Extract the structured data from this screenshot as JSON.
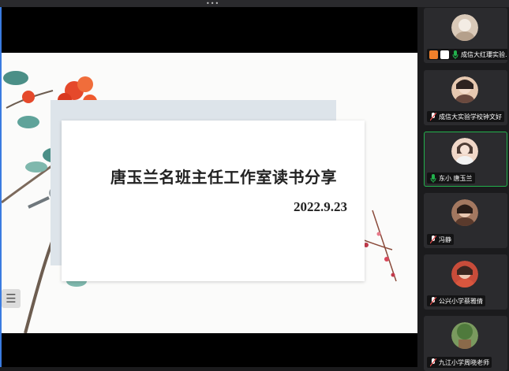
{
  "slide": {
    "title": "唐玉兰名班主任工作室读书分享",
    "date": "2022.9.23"
  },
  "toolbar": {
    "handle_glyph": "•••",
    "list_toggle_glyph": "☰"
  },
  "participants": [
    {
      "name": "成信大红瓔实验…",
      "avatar_color": "#d9c9b8",
      "has_badges": true
    },
    {
      "name": "成信大实验学校钟文好",
      "avatar_color": "#e6c8b0",
      "has_badges": false
    },
    {
      "name": "东小 唐玉兰",
      "avatar_color": "#f0d7c8",
      "has_badges": false,
      "active": true
    },
    {
      "name": "冯静",
      "avatar_color": "#a37860",
      "has_badges": false
    },
    {
      "name": "公兴小学蔡雅倩",
      "avatar_color": "#c84c3a",
      "has_badges": false
    },
    {
      "name": "九江小学周晓老师",
      "avatar_color": "#7a9a5f",
      "has_badges": false
    }
  ],
  "colors": {
    "mic_green": "#22b14c",
    "mic_muted": "#e24a4a",
    "badge_orange": "#f0802b"
  }
}
